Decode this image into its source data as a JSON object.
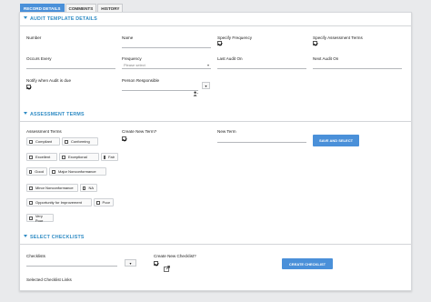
{
  "tabs": [
    "RECORD DETAILS",
    "COMMENTS",
    "HISTORY"
  ],
  "audit": {
    "title": "AUDIT TEMPLATE DETAILS",
    "number_label": "Number",
    "name_label": "Name",
    "specify_frequency_label": "Specify Frequency",
    "specify_terms_label": "Specify Assessment Terms",
    "occurs_label": "Occurs Every",
    "frequency_label": "Frequency",
    "frequency_placeholder": "Please select",
    "last_audit_label": "Last Audit On",
    "next_audit_label": "Next Audit On",
    "notify_label": "Notify when Audit is due",
    "person_label": "Person Responsible"
  },
  "terms": {
    "title": "ASSESSMENT TERMS",
    "terms_label": "Assessment Terms",
    "create_label": "Create New Term?",
    "new_term_label": "New Term",
    "save_button": "SAVE AND SELECT",
    "items": [
      "Compliant",
      "Conforming",
      "Excellent",
      "Exceptional",
      "Fair",
      "Good",
      "Major Nonconformance",
      "Minor Nonconformance",
      "NA",
      "Opportunity for Improvement",
      "Poor",
      "Very Poor"
    ]
  },
  "checklists": {
    "title": "SELECT CHECKLISTS",
    "checklists_label": "Checklists",
    "create_label": "Create New Checklist?",
    "create_button": "CREATE CHECKLIST",
    "selected_label": "Selected Checklist Links"
  },
  "icons": {
    "person": "person-icon",
    "caret": "caret-down-icon",
    "external": "external-link-icon"
  },
  "colors": {
    "accent": "#4a90d9",
    "section": "#2f8bc4"
  }
}
